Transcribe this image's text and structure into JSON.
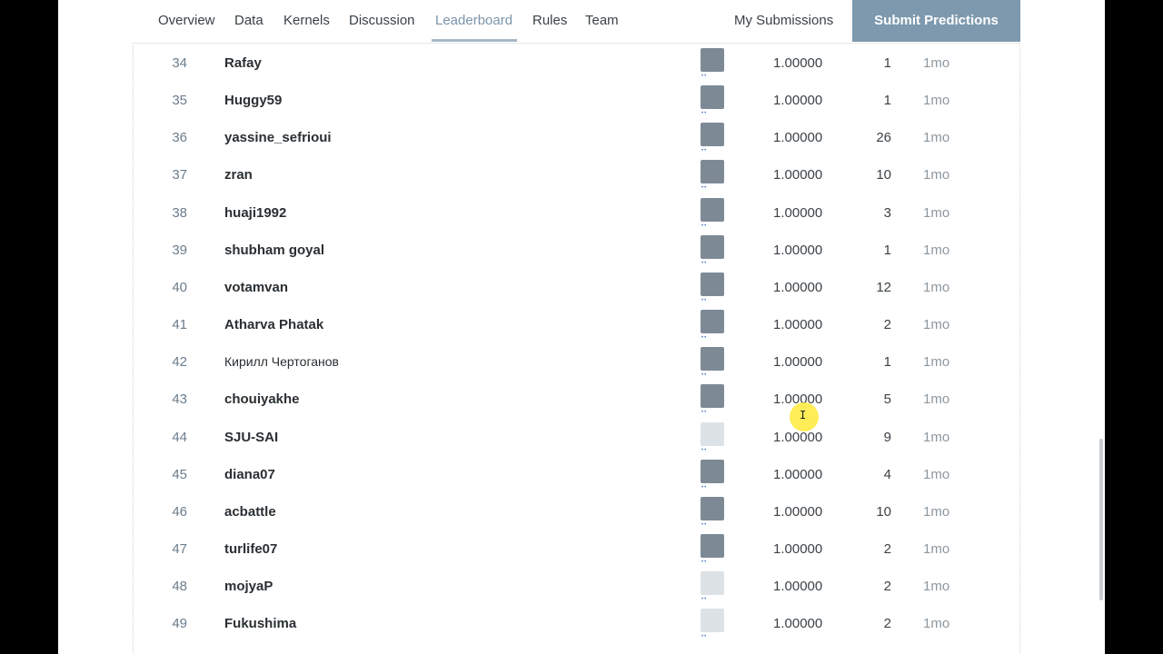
{
  "nav": {
    "tabs": [
      "Overview",
      "Data",
      "Kernels",
      "Discussion",
      "Leaderboard",
      "Rules",
      "Team"
    ],
    "active_tab": "Leaderboard",
    "my_submissions": "My Submissions",
    "submit": "Submit Predictions"
  },
  "leaderboard": {
    "rows": [
      {
        "rank": "34",
        "team": "Rafay",
        "score": "1.00000",
        "entries": "1",
        "last": "1mo"
      },
      {
        "rank": "35",
        "team": "Huggy59",
        "score": "1.00000",
        "entries": "1",
        "last": "1mo"
      },
      {
        "rank": "36",
        "team": "yassine_sefrioui",
        "score": "1.00000",
        "entries": "26",
        "last": "1mo"
      },
      {
        "rank": "37",
        "team": "zran",
        "score": "1.00000",
        "entries": "10",
        "last": "1mo"
      },
      {
        "rank": "38",
        "team": "huaji1992",
        "score": "1.00000",
        "entries": "3",
        "last": "1mo"
      },
      {
        "rank": "39",
        "team": "shubham goyal",
        "score": "1.00000",
        "entries": "1",
        "last": "1mo"
      },
      {
        "rank": "40",
        "team": "votamvan",
        "score": "1.00000",
        "entries": "12",
        "last": "1mo"
      },
      {
        "rank": "41",
        "team": "Atharva Phatak",
        "score": "1.00000",
        "entries": "2",
        "last": "1mo"
      },
      {
        "rank": "42",
        "team": "Кирилл Чертоганов",
        "score": "1.00000",
        "entries": "1",
        "last": "1mo"
      },
      {
        "rank": "43",
        "team": "chouiyakhe",
        "score": "1.00000",
        "entries": "5",
        "last": "1mo"
      },
      {
        "rank": "44",
        "team": "SJU-SAI",
        "score": "1.00000",
        "entries": "9",
        "last": "1mo"
      },
      {
        "rank": "45",
        "team": "diana07",
        "score": "1.00000",
        "entries": "4",
        "last": "1mo"
      },
      {
        "rank": "46",
        "team": "acbattle",
        "score": "1.00000",
        "entries": "10",
        "last": "1mo"
      },
      {
        "rank": "47",
        "team": "turlife07",
        "score": "1.00000",
        "entries": "2",
        "last": "1mo"
      },
      {
        "rank": "48",
        "team": "mojyaP",
        "score": "1.00000",
        "entries": "2",
        "last": "1mo"
      },
      {
        "rank": "49",
        "team": "Fukushima",
        "score": "1.00000",
        "entries": "2",
        "last": "1mo"
      }
    ]
  }
}
